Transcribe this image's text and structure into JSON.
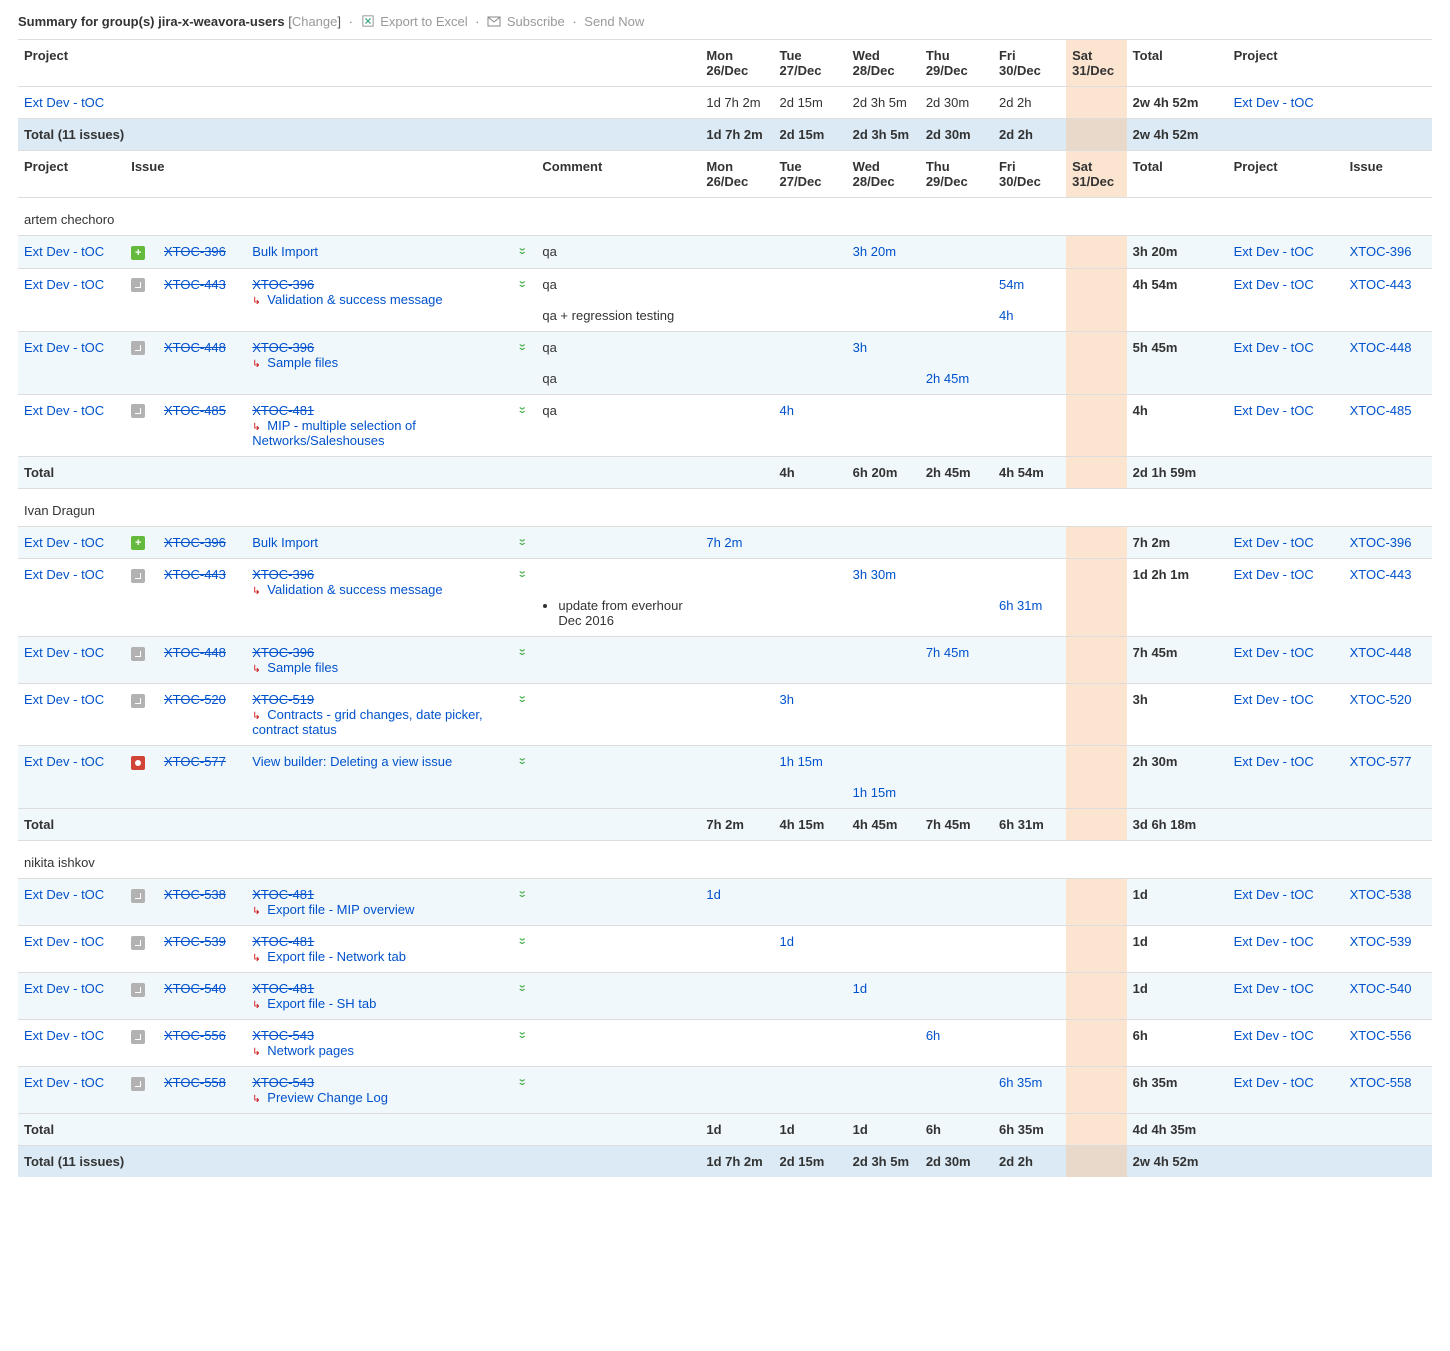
{
  "toolbar": {
    "prefix": "Summary for group(s) ",
    "group": "jira-x-weavora-users",
    "change": "Change",
    "export": "Export to Excel",
    "subscribe": "Subscribe",
    "send": "Send Now"
  },
  "cols": {
    "project": "Project",
    "issue": "Issue",
    "comment": "Comment",
    "total": "Total",
    "days": [
      {
        "top": "Mon",
        "bot": "26/Dec"
      },
      {
        "top": "Tue",
        "bot": "27/Dec"
      },
      {
        "top": "Wed",
        "bot": "28/Dec"
      },
      {
        "top": "Thu",
        "bot": "29/Dec"
      },
      {
        "top": "Fri",
        "bot": "30/Dec"
      },
      {
        "top": "Sat",
        "bot": "31/Dec"
      }
    ]
  },
  "top": {
    "project": "Ext Dev - tOC",
    "days": [
      "1d 7h 2m",
      "2d 15m",
      "2d 3h 5m",
      "2d 30m",
      "2d 2h",
      ""
    ],
    "total": "2w 4h 52m",
    "total_label": "Total (11 issues)"
  },
  "users": [
    {
      "name": "artem chechoro",
      "rows": [
        {
          "issue": "XTOC-396",
          "icon": "story",
          "parent": null,
          "parentStrike": null,
          "detail": "Bulk Import",
          "detailStrike": false,
          "alt": true,
          "comments": [
            {
              "txt": "qa",
              "days": [
                "",
                "",
                "3h 20m",
                "",
                "",
                ""
              ]
            }
          ],
          "total": "3h 20m"
        },
        {
          "issue": "XTOC-443",
          "icon": "subtask",
          "parent": "XTOC-396",
          "parentStrike": true,
          "detail": "Validation & success message",
          "detailStrike": false,
          "alt": false,
          "comments": [
            {
              "txt": "qa",
              "days": [
                "",
                "",
                "",
                "",
                "54m",
                ""
              ]
            },
            {
              "txt": "qa + regression testing",
              "days": [
                "",
                "",
                "",
                "",
                "4h",
                ""
              ]
            }
          ],
          "total": "4h 54m"
        },
        {
          "issue": "XTOC-448",
          "icon": "subtask",
          "parent": "XTOC-396",
          "parentStrike": true,
          "detail": "Sample files",
          "detailStrike": false,
          "alt": true,
          "comments": [
            {
              "txt": "qa",
              "days": [
                "",
                "",
                "3h",
                "",
                "",
                ""
              ]
            },
            {
              "txt": "qa",
              "days": [
                "",
                "",
                "",
                "2h 45m",
                "",
                ""
              ]
            }
          ],
          "total": "5h 45m"
        },
        {
          "issue": "XTOC-485",
          "icon": "subtask",
          "parent": "XTOC-481",
          "parentStrike": true,
          "detail": "MIP - multiple selection of Networks/Saleshouses",
          "detailStrike": false,
          "alt": false,
          "comments": [
            {
              "txt": "qa",
              "days": [
                "",
                "4h",
                "",
                "",
                "",
                ""
              ]
            }
          ],
          "total": "4h"
        }
      ],
      "subtotal": {
        "label": "Total",
        "days": [
          "",
          "4h",
          "6h 20m",
          "2h 45m",
          "4h 54m",
          ""
        ],
        "total": "2d 1h 59m"
      }
    },
    {
      "name": "Ivan Dragun",
      "rows": [
        {
          "issue": "XTOC-396",
          "icon": "story",
          "parent": null,
          "detail": "Bulk Import",
          "detailStrike": false,
          "alt": true,
          "comments": [
            {
              "txt": "",
              "days": [
                "7h 2m",
                "",
                "",
                "",
                "",
                ""
              ]
            }
          ],
          "total": "7h 2m"
        },
        {
          "issue": "XTOC-443",
          "icon": "subtask",
          "parent": "XTOC-396",
          "parentStrike": true,
          "detail": "Validation & success message",
          "detailStrike": false,
          "alt": false,
          "comments": [
            {
              "txt": "",
              "days": [
                "",
                "",
                "3h 30m",
                "",
                "",
                ""
              ]
            },
            {
              "txt": "update from everhour Dec 2016",
              "bullet": true,
              "days": [
                "",
                "",
                "",
                "",
                "6h 31m",
                ""
              ]
            }
          ],
          "total": "1d 2h 1m"
        },
        {
          "issue": "XTOC-448",
          "icon": "subtask",
          "parent": "XTOC-396",
          "parentStrike": true,
          "detail": "Sample files",
          "detailStrike": false,
          "alt": true,
          "comments": [
            {
              "txt": "",
              "days": [
                "",
                "",
                "",
                "7h 45m",
                "",
                ""
              ]
            }
          ],
          "total": "7h 45m"
        },
        {
          "issue": "XTOC-520",
          "icon": "subtask",
          "parent": "XTOC-519",
          "parentStrike": true,
          "detail": "Contracts - grid changes, date picker, contract status",
          "detailStrike": false,
          "alt": false,
          "comments": [
            {
              "txt": "",
              "days": [
                "",
                "3h",
                "",
                "",
                "",
                ""
              ]
            }
          ],
          "total": "3h"
        },
        {
          "issue": "XTOC-577",
          "icon": "bug",
          "parent": null,
          "detail": "View builder: Deleting a view issue",
          "detailStrike": false,
          "alt": true,
          "comments": [
            {
              "txt": "",
              "days": [
                "",
                "1h 15m",
                "",
                "",
                "",
                ""
              ]
            },
            {
              "txt": "",
              "days": [
                "",
                "",
                "1h 15m",
                "",
                "",
                ""
              ]
            }
          ],
          "total": "2h 30m"
        }
      ],
      "subtotal": {
        "label": "Total",
        "days": [
          "7h 2m",
          "4h 15m",
          "4h 45m",
          "7h 45m",
          "6h 31m",
          ""
        ],
        "total": "3d 6h 18m"
      }
    },
    {
      "name": "nikita ishkov",
      "rows": [
        {
          "issue": "XTOC-538",
          "icon": "subtask",
          "parent": "XTOC-481",
          "parentStrike": true,
          "detail": "Export file - MIP overview",
          "detailStrike": false,
          "alt": true,
          "comments": [
            {
              "txt": "",
              "days": [
                "1d",
                "",
                "",
                "",
                "",
                ""
              ]
            }
          ],
          "total": "1d"
        },
        {
          "issue": "XTOC-539",
          "icon": "subtask",
          "parent": "XTOC-481",
          "parentStrike": true,
          "detail": "Export file - Network tab",
          "detailStrike": false,
          "alt": false,
          "comments": [
            {
              "txt": "",
              "days": [
                "",
                "1d",
                "",
                "",
                "",
                ""
              ]
            }
          ],
          "total": "1d"
        },
        {
          "issue": "XTOC-540",
          "icon": "subtask",
          "parent": "XTOC-481",
          "parentStrike": true,
          "detail": "Export file - SH tab",
          "detailStrike": false,
          "alt": true,
          "comments": [
            {
              "txt": "",
              "days": [
                "",
                "",
                "1d",
                "",
                "",
                ""
              ]
            }
          ],
          "total": "1d"
        },
        {
          "issue": "XTOC-556",
          "icon": "subtask",
          "parent": "XTOC-543",
          "parentStrike": true,
          "detail": "Network pages",
          "detailStrike": false,
          "alt": false,
          "comments": [
            {
              "txt": "",
              "days": [
                "",
                "",
                "",
                "6h",
                "",
                ""
              ]
            }
          ],
          "total": "6h"
        },
        {
          "issue": "XTOC-558",
          "icon": "subtask",
          "parent": "XTOC-543",
          "parentStrike": true,
          "detail": "Preview Change Log",
          "detailStrike": false,
          "alt": true,
          "comments": [
            {
              "txt": "",
              "days": [
                "",
                "",
                "",
                "",
                "6h 35m",
                ""
              ]
            }
          ],
          "total": "6h 35m"
        }
      ],
      "subtotal": {
        "label": "Total",
        "days": [
          "1d",
          "1d",
          "1d",
          "6h",
          "6h 35m",
          ""
        ],
        "total": "4d 4h 35m"
      }
    }
  ],
  "grand": {
    "label": "Total (11 issues)",
    "days": [
      "1d 7h 2m",
      "2d 15m",
      "2d 3h 5m",
      "2d 30m",
      "2d 2h",
      ""
    ],
    "total": "2w 4h 52m"
  }
}
